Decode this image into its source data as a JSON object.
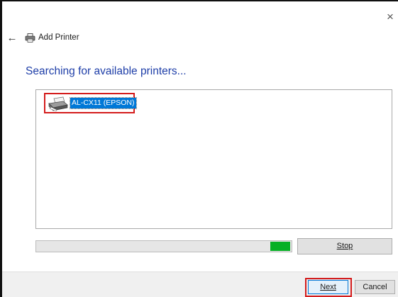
{
  "window": {
    "title": "Add Printer",
    "close_glyph": "×",
    "back_glyph": "←"
  },
  "page": {
    "heading": "Searching for available printers..."
  },
  "printer_list": {
    "items": [
      {
        "label": "AL-CX11 (EPSON)",
        "icon": "printer-icon",
        "selected": true
      }
    ]
  },
  "search_progress": {
    "state": "indeterminate (marquee)",
    "color": "#06b025"
  },
  "buttons": {
    "stop_label": "Stop",
    "next_label": "Next",
    "cancel_label": "Cancel"
  },
  "colors": {
    "heading": "#1e3ea8",
    "selection": "#0078d7",
    "highlight_box": "#d41c1c"
  }
}
